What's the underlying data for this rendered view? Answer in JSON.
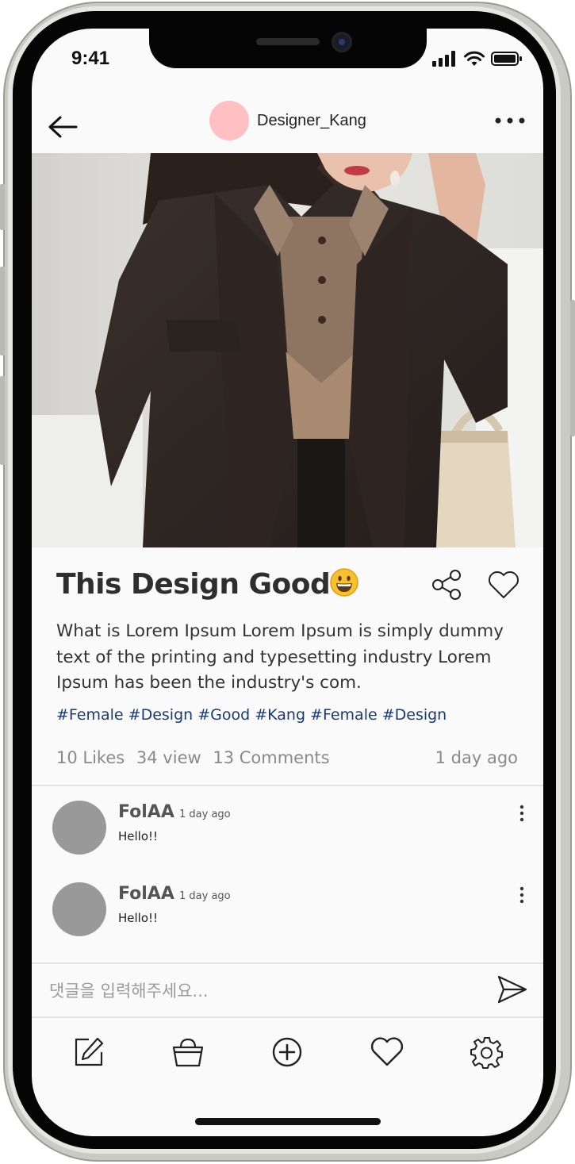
{
  "status_bar": {
    "time": "9:41"
  },
  "header": {
    "username": "Designer_Kang",
    "avatar_color": "#ffc0c4"
  },
  "photo": {
    "alt": "Woman wearing a dark brown wool coat over a knit top, holding a cream handbag"
  },
  "post": {
    "title": "This Design Good",
    "title_emoji": "grinning-face",
    "description": "What is Lorem Ipsum Lorem Ipsum is simply dummy text of the printing and typesetting industry Lorem Ipsum has been the industry's com.",
    "hashtags": "#Female #Design #Good #Kang #Female #Design",
    "likes": "10 Likes",
    "views": "34 view",
    "comments_count": "13 Comments",
    "posted_ago": "1 day ago"
  },
  "comments": [
    {
      "author": "FolAA",
      "time": "1 day ago",
      "text": "Hello!!"
    },
    {
      "author": "FolAA",
      "time": "1 day ago",
      "text": "Hello!!"
    }
  ],
  "comment_input": {
    "placeholder": "댓글을 입력해주세요..."
  },
  "bottom_nav": {
    "items": [
      {
        "icon": "edit-icon"
      },
      {
        "icon": "shopping-basket-icon"
      },
      {
        "icon": "add-circle-icon"
      },
      {
        "icon": "heart-icon"
      },
      {
        "icon": "settings-icon"
      }
    ]
  },
  "colors": {
    "hashtag": "#1b3a72",
    "meta_text": "#8a8a8a",
    "comment_avatar": "#999999",
    "screen_bg": "#fafafa"
  }
}
